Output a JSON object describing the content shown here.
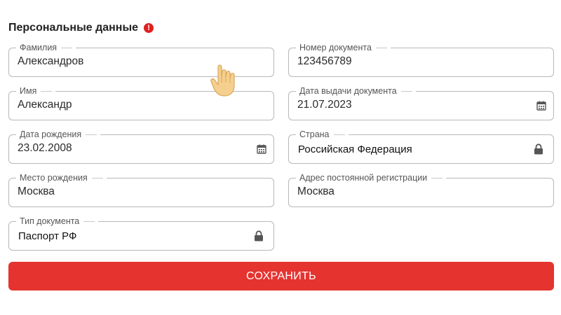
{
  "section": {
    "title": "Персональные данные",
    "warning_glyph": "!",
    "warning_icon": "exclamation-circle-icon"
  },
  "fields": {
    "surname": {
      "label": "Фамилия",
      "value": "Александров"
    },
    "doc_number": {
      "label": "Номер документа",
      "value": "123456789"
    },
    "name": {
      "label": "Имя",
      "value": "Александр"
    },
    "issue_date": {
      "label": "Дата выдачи документа",
      "value": "21.07.2023",
      "icon": "calendar-icon"
    },
    "birth_date": {
      "label": "Дата рождения",
      "value": "23.02.2008",
      "icon": "calendar-icon"
    },
    "country": {
      "label": "Страна",
      "value": "Российская Федерация",
      "icon": "lock-icon"
    },
    "birth_place": {
      "label": "Место рождения",
      "value": "Москва"
    },
    "address": {
      "label": "Адрес постоянной регистрации",
      "value": "Москва"
    },
    "doc_type": {
      "label": "Тип документа",
      "value": "Паспорт РФ",
      "icon": "lock-icon"
    }
  },
  "actions": {
    "save_label": "СОХРАНИТЬ"
  },
  "colors": {
    "accent": "#e53330",
    "warning": "#e02020",
    "border": "#b8b8b8"
  }
}
